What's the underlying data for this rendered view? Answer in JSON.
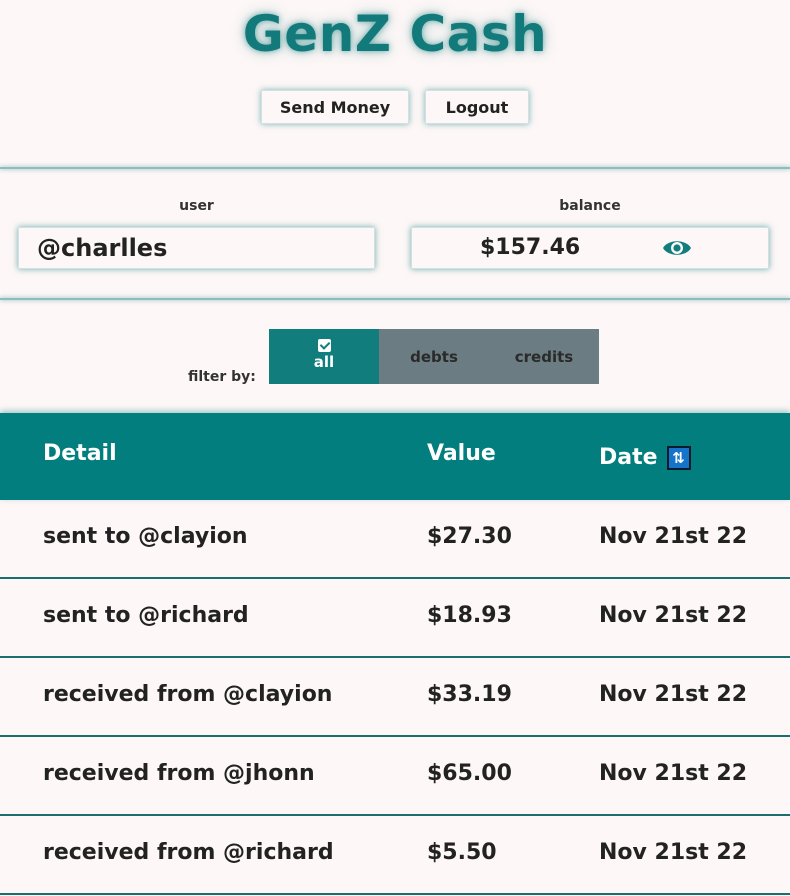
{
  "app": {
    "title": "GenZ Cash"
  },
  "actions": {
    "send_money": "Send Money",
    "logout": "Logout"
  },
  "account": {
    "user_label": "user",
    "user_value": "@charlles",
    "balance_label": "balance",
    "balance_value": "$157.46",
    "balance_visibility_icon": "eye-icon"
  },
  "filter": {
    "label": "filter by:",
    "options": [
      {
        "label": "all",
        "active": true,
        "icon": "check-icon"
      },
      {
        "label": "debts",
        "active": false
      },
      {
        "label": "credits",
        "active": false
      }
    ]
  },
  "table": {
    "headers": {
      "detail": "Detail",
      "value": "Value",
      "date": "Date",
      "date_sort_icon": "sort-icon"
    },
    "rows": [
      {
        "detail": "sent to @clayion",
        "value": "$27.30",
        "date": "Nov 21st 22"
      },
      {
        "detail": "sent to @richard",
        "value": "$18.93",
        "date": "Nov 21st 22"
      },
      {
        "detail": "received from @clayion",
        "value": "$33.19",
        "date": "Nov 21st 22"
      },
      {
        "detail": "received from @jhonn",
        "value": "$65.00",
        "date": "Nov 21st 22"
      },
      {
        "detail": "received from @richard",
        "value": "$5.50",
        "date": "Nov 21st 22"
      }
    ]
  },
  "colors": {
    "background": "#fdf7f7",
    "brand_teal": "#117d7c",
    "filter_inactive": "#6b7c82",
    "sort_icon_blue": "#1574c9"
  }
}
